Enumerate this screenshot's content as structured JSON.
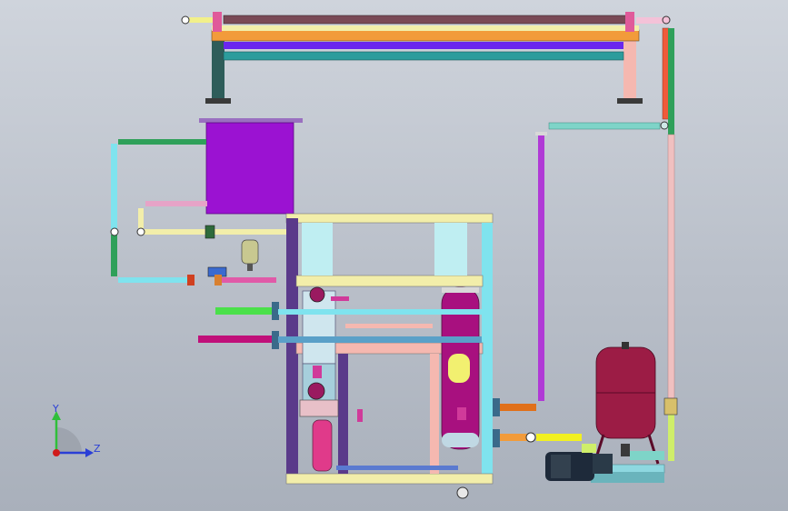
{
  "viewport": {
    "background_top": "#cfd4dc",
    "background_bottom": "#a9b0bb"
  },
  "triad": {
    "y_label": "Y",
    "z_label": "Z",
    "y_color": "#2fbf3a",
    "z_color": "#2a3fd6",
    "origin_color": "#d01b1b"
  },
  "colors": {
    "frame_yellow": "#f2eeaa",
    "frame_purple": "#5a3a8a",
    "frame_pink": "#f5b8b0",
    "frame_cyan": "#7fe3ee",
    "header_tank": "#a8107f",
    "magenta_box": "#9b12d2",
    "orange_bar": "#f29b3a",
    "blue_bar": "#6a26ee",
    "teal_pipe": "#2c9c9c",
    "green_pipe": "#2fa05a",
    "salmon_pipe": "#f0a8a0",
    "expansion_tank": "#9c1c45",
    "pump_body": "#1e2a3a",
    "base_plate": "#8ed8e0"
  }
}
